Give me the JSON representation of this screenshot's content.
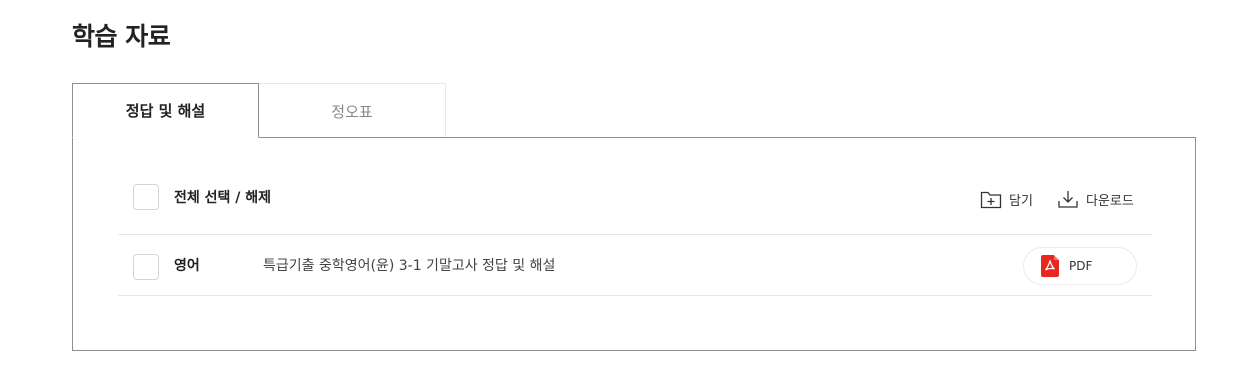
{
  "page": {
    "title": "학습 자료"
  },
  "tabs": [
    {
      "label": "정답 및 해설",
      "active": true
    },
    {
      "label": "정오표",
      "active": false
    }
  ],
  "toolbar": {
    "select_all_label": "전체 선택 / 해제",
    "save_label": "담기",
    "download_label": "다운로드",
    "save_icon": "folder-add-icon",
    "download_icon": "download-icon"
  },
  "files": [
    {
      "subject": "영어",
      "title": "특급기출 중학영어(윤) 3-1 기말고사 정답 및 해설",
      "format": "PDF",
      "checked": false
    }
  ],
  "colors": {
    "pdf_accent": "#e8281e",
    "border": "#8f8f8f"
  }
}
